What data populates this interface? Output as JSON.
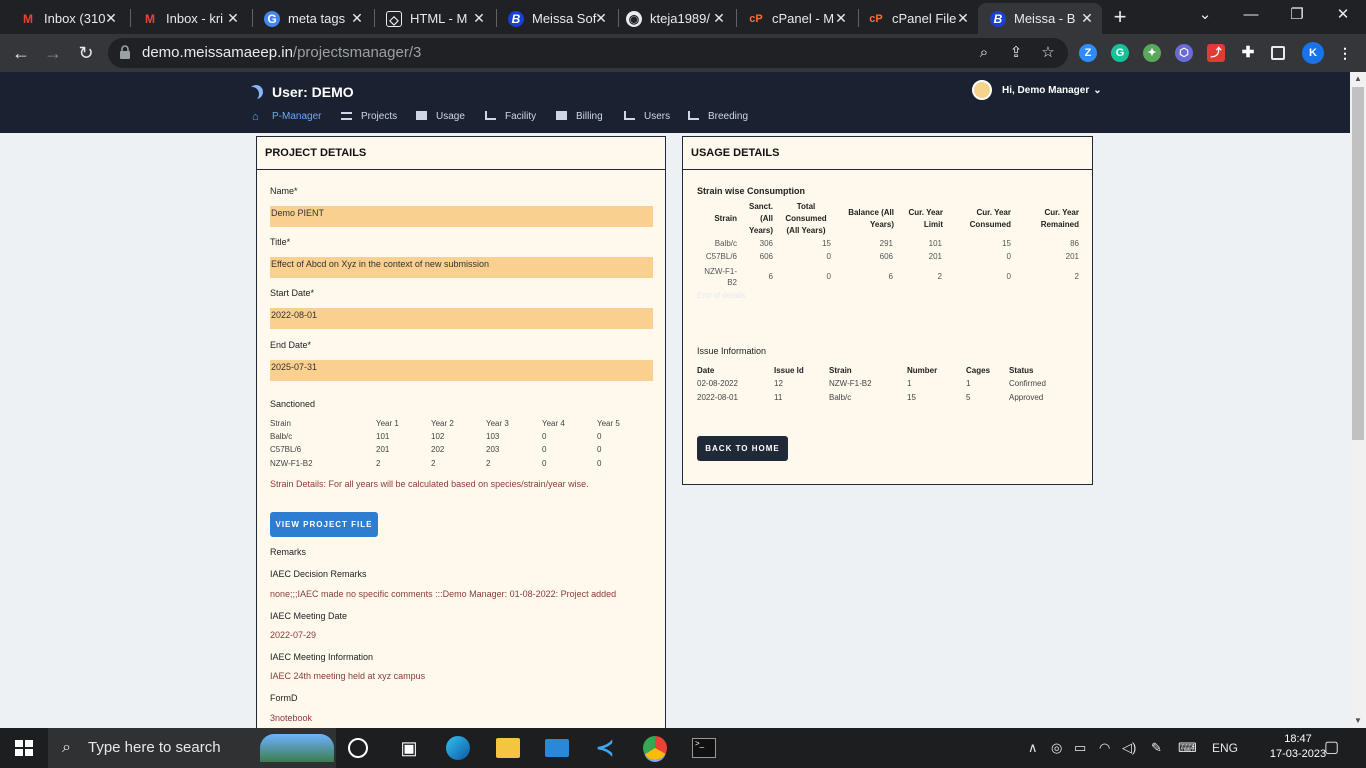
{
  "browser": {
    "tabs": [
      {
        "title": "Inbox (310",
        "icon": "gmail-icon"
      },
      {
        "title": "Inbox - kri",
        "icon": "gmail-icon"
      },
      {
        "title": "meta tags",
        "icon": "google-icon"
      },
      {
        "title": "HTML - M",
        "icon": "html-icon"
      },
      {
        "title": "Meissa Sof",
        "icon": "meissa-icon"
      },
      {
        "title": "kteja1989/",
        "icon": "github-icon"
      },
      {
        "title": "cPanel - M",
        "icon": "cpanel-icon"
      },
      {
        "title": "cPanel File",
        "icon": "cpanel-icon"
      },
      {
        "title": "Meissa - B",
        "icon": "meissa-icon"
      }
    ],
    "url_host": "demo.meissamaeep.in",
    "url_path": "/projectsmanager/3",
    "profile_initial": "K"
  },
  "app": {
    "user_title": "User: DEMO",
    "greeting": "Hi, Demo Manager",
    "menu": [
      {
        "label": "P-Manager",
        "icon": "home-icon"
      },
      {
        "label": "Projects",
        "icon": "list-icon"
      },
      {
        "label": "Usage",
        "icon": "envelope-icon"
      },
      {
        "label": "Facility",
        "icon": "chart-icon"
      },
      {
        "label": "Billing",
        "icon": "table-icon"
      },
      {
        "label": "Users",
        "icon": "chart-icon"
      },
      {
        "label": "Breeding",
        "icon": "chart-icon"
      }
    ]
  },
  "project": {
    "heading": "PROJECT DETAILS",
    "name_label": "Name*",
    "name_value": "Demo PIENT",
    "title_label": "Title*",
    "title_value": "Effect of Abcd on Xyz in the context of new submission",
    "start_label": "Start Date*",
    "start_value": "2022-08-01",
    "end_label": "End Date*",
    "end_value": "2025-07-31",
    "sanctioned_label": "Sanctioned",
    "sanctioned_headers": [
      "Strain",
      "Year 1",
      "Year 2",
      "Year 3",
      "Year 4",
      "Year 5"
    ],
    "sanctioned_rows": [
      [
        "Balb/c",
        "101",
        "102",
        "103",
        "0",
        "0"
      ],
      [
        "C57BL/6",
        "201",
        "202",
        "203",
        "0",
        "0"
      ],
      [
        "NZW-F1-B2",
        "2",
        "2",
        "2",
        "0",
        "0"
      ]
    ],
    "strain_details": "Strain Details: For all years will be calculated based on species/strain/year wise.",
    "view_file_button": "VIEW PROJECT FILE",
    "remarks_label": "Remarks",
    "iaec_remarks_label": "IAEC Decision Remarks",
    "iaec_remarks_value": "none;;;IAEC made no specific comments :::Demo Manager: 01-08-2022: Project added",
    "meeting_date_label": "IAEC Meeting Date",
    "meeting_date_value": "2022-07-29",
    "meeting_info_label": "IAEC Meeting Information",
    "meeting_info_value": "IAEC 24th meeting held at xyz campus",
    "formd_label": "FormD",
    "formd_value": "3notebook"
  },
  "usage": {
    "heading": "USAGE DETAILS",
    "strain_consumption_label": "Strain wise Consumption",
    "consumption_headers": [
      "Strain",
      "Sanct. (All Years)",
      "Total Consumed (All Years)",
      "Balance (All Years)",
      "Cur. Year Limit",
      "Cur. Year Consumed",
      "Cur. Year Remained"
    ],
    "consumption_rows": [
      [
        "Balb/c",
        "306",
        "15",
        "291",
        "101",
        "15",
        "86"
      ],
      [
        "C57BL/6",
        "606",
        "0",
        "606",
        "201",
        "0",
        "201"
      ],
      [
        "NZW-F1-B2",
        "6",
        "0",
        "6",
        "2",
        "0",
        "2"
      ]
    ],
    "faded_note": "End of details",
    "issue_label": "Issue Information",
    "issue_headers": [
      "Date",
      "Issue Id",
      "Strain",
      "Number",
      "Cages",
      "Status"
    ],
    "issue_rows": [
      [
        "02-08-2022",
        "12",
        "NZW-F1-B2",
        "1",
        "1",
        "Confirmed"
      ],
      [
        "2022-08-01",
        "11",
        "Balb/c",
        "15",
        "5",
        "Approved"
      ]
    ],
    "back_button": "BACK TO HOME"
  },
  "taskbar": {
    "search_placeholder": "Type here to search",
    "language": "ENG",
    "time": "18:47",
    "date": "17-03-2023"
  },
  "colors": {
    "nav_bg": "#1a2231",
    "panel_bg": "#fff9ed",
    "field_bg": "#f9d08f",
    "primary_button": "#2f7dd1",
    "dark_button": "#1f2937"
  }
}
